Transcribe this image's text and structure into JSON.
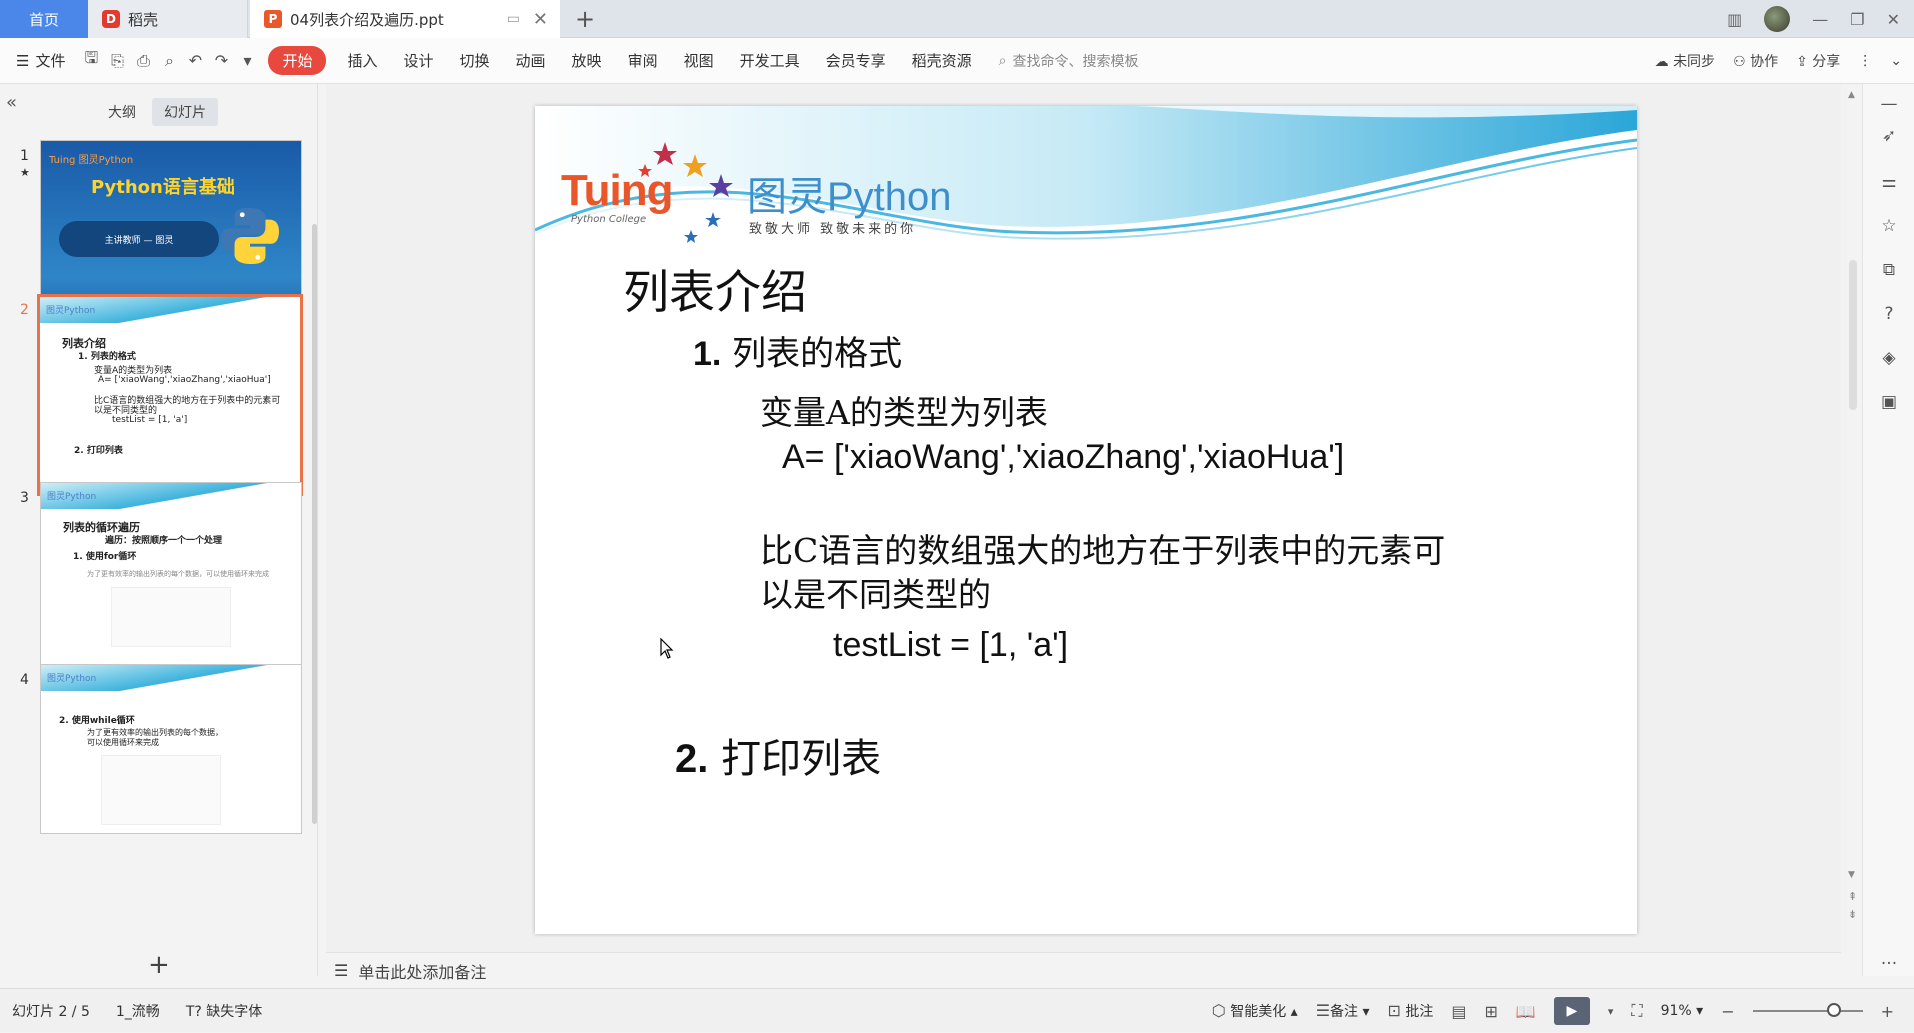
{
  "titlebar": {
    "tab_home": "首页",
    "tab_daoke": "稻壳",
    "tab_doc": "04列表介绍及遍历.ppt",
    "new_tab": "+",
    "close": "✕"
  },
  "menubar": {
    "file": "文件",
    "items": [
      "开始",
      "插入",
      "设计",
      "切换",
      "动画",
      "放映",
      "审阅",
      "视图",
      "开发工具",
      "会员专享",
      "稻壳资源"
    ],
    "search_placeholder": "查找命令、搜索模板",
    "right": {
      "sync": "未同步",
      "collab": "协作",
      "share": "分享"
    }
  },
  "leftpanel": {
    "view_tabs": [
      "大纲",
      "幻灯片"
    ],
    "active_view": "幻灯片",
    "slide_numbers": [
      "1",
      "2",
      "3",
      "4"
    ],
    "thumb1": {
      "logo": "Tuing 图灵Python",
      "title": "Python语言基础",
      "pill": "主讲教师 — 图灵"
    },
    "thumb2": {
      "heading": "列表介绍",
      "h1": "1. 列表的格式",
      "l1": "变量A的类型为列表",
      "l2": "A= ['xiaoWang','xiaoZhang','xiaoHua']",
      "l3": "比C语言的数组强大的地方在于列表中的元素可",
      "l4": "以是不同类型的",
      "l5": "testList = [1, 'a']",
      "h2": "2. 打印列表"
    },
    "thumb3": {
      "heading": "列表的循环遍历",
      "sub": "遍历：按照顺序一个一个处理",
      "h1": "1. 使用for循环",
      "l1": "为了更有效率的输出列表的每个数据，可以使用循环来完成"
    },
    "thumb4": {
      "heading": "2. 使用while循环",
      "l1": "为了更有效率的输出列表的每个数据，",
      "l2": "可以使用循环来完成"
    }
  },
  "slide": {
    "logo_brand": "Tuing",
    "logo_college": "Python College",
    "logo_main": "图灵Python",
    "logo_sub": "致敬大师    致敬未来的你",
    "heading": "列表介绍",
    "h1_num": "1.",
    "h1_text": "列表的格式",
    "line1": "变量A的类型为列表",
    "line2": "A= ['xiaoWang','xiaoZhang','xiaoHua']",
    "line3": "比C语言的数组强大的地方在于列表中的元素可",
    "line4": "以是不同类型的",
    "line5": "testList = [1, 'a']",
    "h2_num": "2.",
    "h2_text": "打印列表"
  },
  "notes": {
    "placeholder": "单击此处添加备注"
  },
  "statusbar": {
    "slide_pos": "幻灯片 2 / 5",
    "theme": "1_流畅",
    "missing_font": "缺失字体",
    "beautify": "智能美化",
    "notes": "备注",
    "comment": "批注",
    "zoom": "91%",
    "zoom_level": 0.91
  },
  "colors": {
    "accent": "#e8493f",
    "home_tab": "#4a87e8",
    "selected_thumb": "#e8734a",
    "logo_orange": "#e8562a",
    "logo_blue": "#3d8fcc"
  }
}
